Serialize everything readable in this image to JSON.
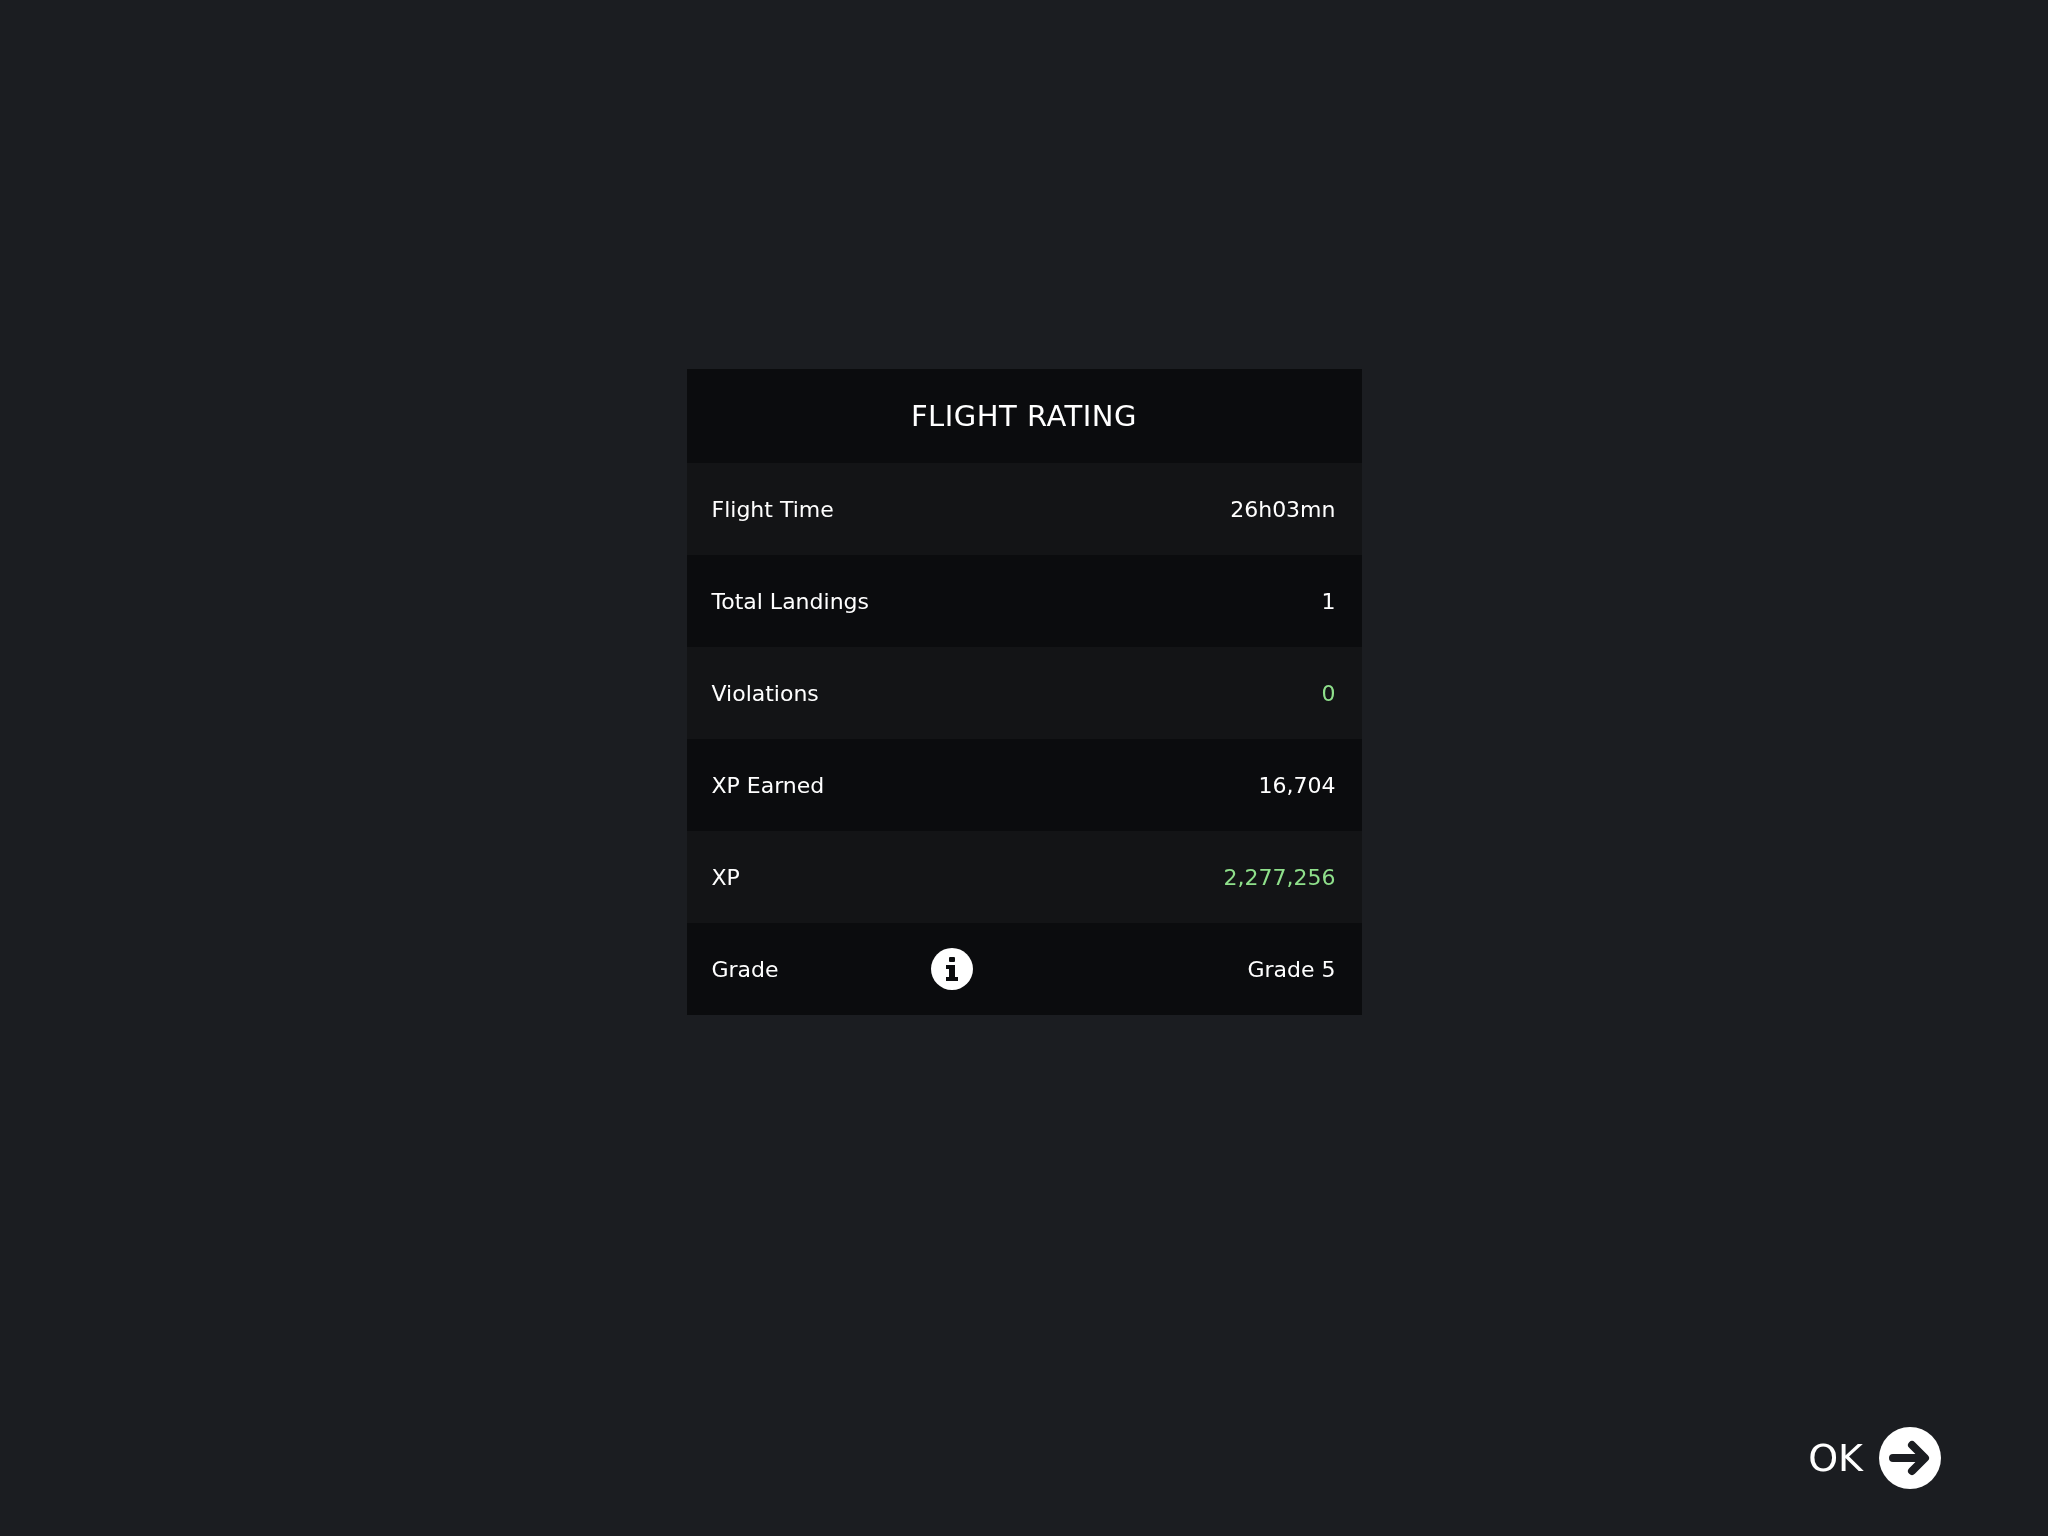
{
  "dialog": {
    "title": "FLIGHT RATING",
    "rows": [
      {
        "kind": "plain",
        "label": "Flight Time",
        "value": "26h03mn",
        "color": "#ffffff"
      },
      {
        "kind": "plain",
        "label": "Total Landings",
        "value": "1",
        "color": "#ffffff"
      },
      {
        "kind": "plain",
        "label": "Violations",
        "value": "0",
        "color": "#8fe08b"
      },
      {
        "kind": "plain",
        "label": "XP Earned",
        "value": "16,704",
        "color": "#ffffff"
      },
      {
        "kind": "plain",
        "label": "XP",
        "value": "2,277,256",
        "color": "#8fe08b"
      },
      {
        "kind": "info",
        "label": "Grade",
        "value": "Grade 5",
        "color": "#ffffff"
      }
    ]
  },
  "ok_button": {
    "label": "OK"
  }
}
